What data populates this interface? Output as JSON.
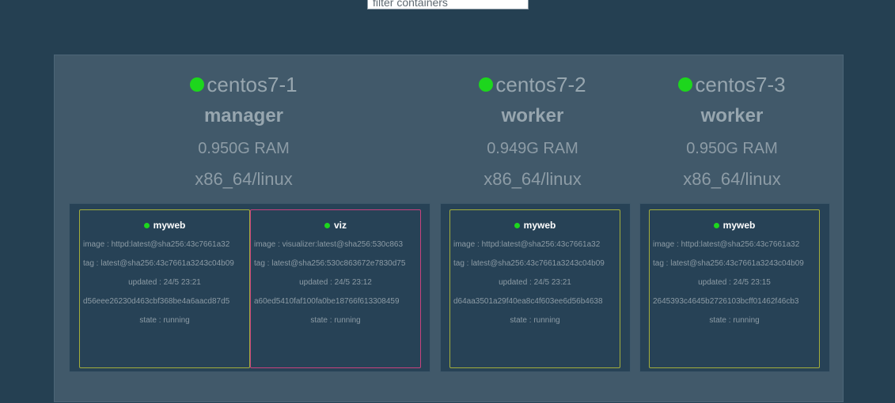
{
  "filter": {
    "placeholder": "filter containers"
  },
  "colors": {
    "background": "#254052",
    "cluster_panel": "#41596a",
    "task_area": "#274256",
    "status_green": "#1dd61d",
    "border_olive": "#a3ae3c",
    "border_pink": "#c7427e"
  },
  "nodes": [
    {
      "name": "centos7-1",
      "role": "manager",
      "ram": "0.950G RAM",
      "os": "x86_64/linux",
      "tasks": [
        {
          "name": "myweb",
          "image": "image : httpd:latest@sha256:43c7661a32",
          "tag": "tag : latest@sha256:43c7661a3243c04b09",
          "updated": "updated : 24/5 23:21",
          "id": "d56eee26230d463cbf368be4a6aacd87d5",
          "state": "state : running"
        },
        {
          "name": "viz",
          "image": "image : visualizer:latest@sha256:530c863",
          "tag": "tag : latest@sha256:530c863672e7830d75",
          "updated": "updated : 24/5 23:12",
          "id": "a60ed5410faf100fa0be18766f613308459",
          "state": "state : running"
        }
      ]
    },
    {
      "name": "centos7-2",
      "role": "worker",
      "ram": "0.949G RAM",
      "os": "x86_64/linux",
      "tasks": [
        {
          "name": "myweb",
          "image": "image : httpd:latest@sha256:43c7661a32",
          "tag": "tag : latest@sha256:43c7661a3243c04b09",
          "updated": "updated : 24/5 23:21",
          "id": "d64aa3501a29f40ea8c4f603ee6d56b4638",
          "state": "state : running"
        }
      ]
    },
    {
      "name": "centos7-3",
      "role": "worker",
      "ram": "0.950G RAM",
      "os": "x86_64/linux",
      "tasks": [
        {
          "name": "myweb",
          "image": "image : httpd:latest@sha256:43c7661a32",
          "tag": "tag : latest@sha256:43c7661a3243c04b09",
          "updated": "updated : 24/5 23:15",
          "id": "2645393c4645b2726103bcff01462f46cb3",
          "state": "state : running"
        }
      ]
    }
  ]
}
